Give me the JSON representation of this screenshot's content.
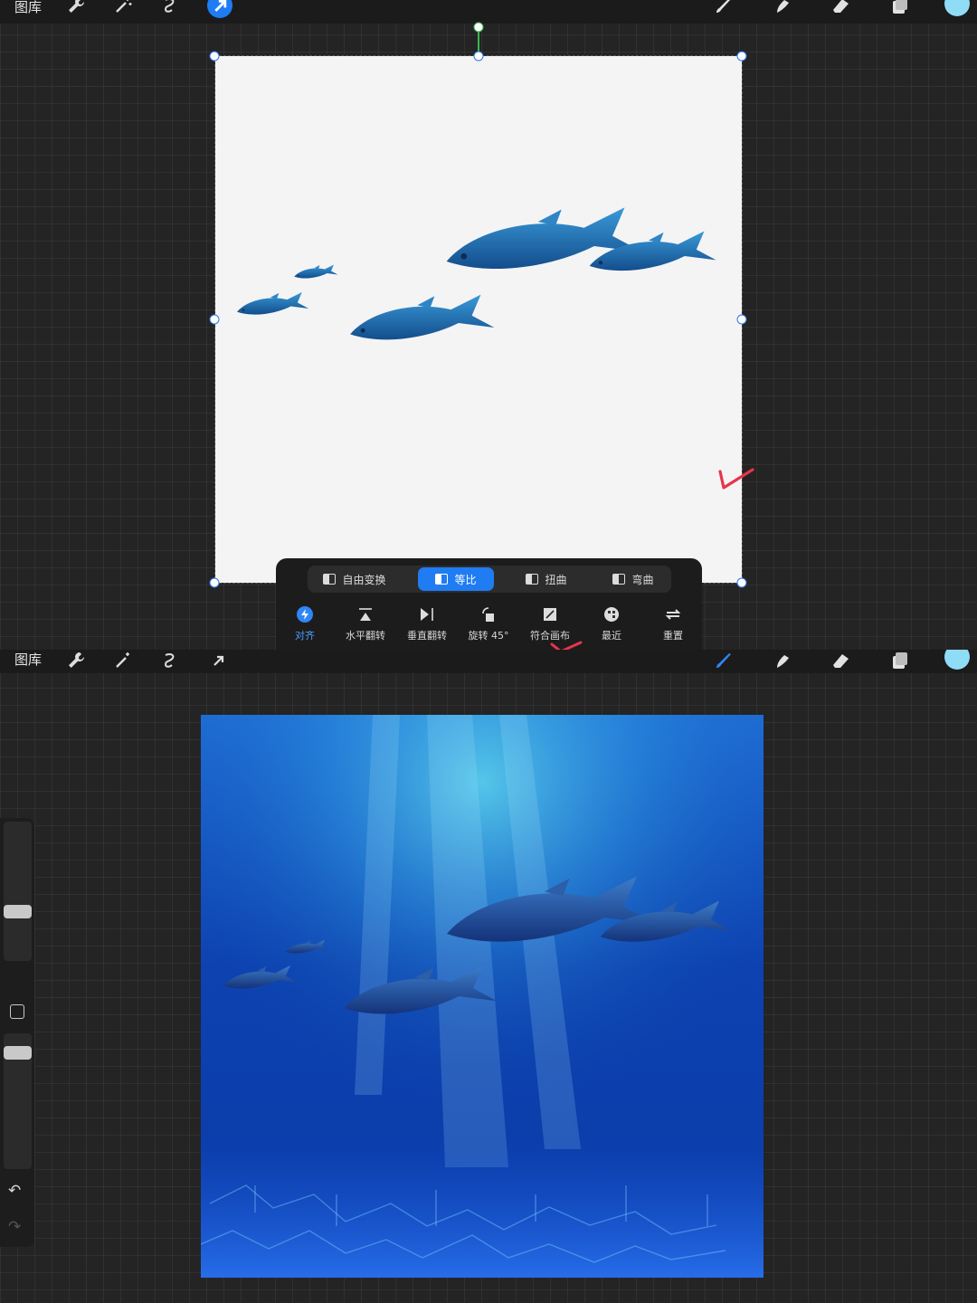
{
  "top_panel": {
    "gallery_label": "图库",
    "toolbar_icons": [
      "wrench-icon",
      "magic-wand-icon",
      "selection-icon",
      "transform-arrow-icon"
    ],
    "right_tools": [
      "brush-icon",
      "smudge-icon",
      "eraser-icon",
      "layers-icon"
    ],
    "color_swatch": "#8fdcf7",
    "transform_modes": [
      {
        "label": "自由变换",
        "active": false
      },
      {
        "label": "等比",
        "active": true
      },
      {
        "label": "扭曲",
        "active": false
      },
      {
        "label": "弯曲",
        "active": false
      }
    ],
    "transform_options": [
      {
        "label": "对齐",
        "icon": "snapping-icon",
        "active": true
      },
      {
        "label": "水平翻转",
        "icon": "flip-horizontal-icon"
      },
      {
        "label": "垂直翻转",
        "icon": "flip-vertical-icon"
      },
      {
        "label": "旋转 45°",
        "icon": "rotate-icon"
      },
      {
        "label": "符合画布",
        "icon": "fit-canvas-icon"
      },
      {
        "label": "最近",
        "icon": "interpolation-icon"
      },
      {
        "label": "重置",
        "icon": "reset-icon"
      }
    ],
    "accent_color": "#1f7cf2"
  },
  "bottom_panel": {
    "gallery_label": "图库",
    "toolbar_icons": [
      "wrench-icon",
      "magic-wand-icon",
      "selection-icon",
      "transform-arrow-icon"
    ],
    "right_tools": [
      "brush-icon",
      "smudge-icon",
      "eraser-icon",
      "layers-icon"
    ],
    "color_swatch": "#8fdcf7",
    "sidebar_controls": [
      "brush-size-slider",
      "modify-button",
      "opacity-slider",
      "undo-icon",
      "redo-icon"
    ],
    "brush_size_level": 0.4,
    "opacity_level": 0.75
  }
}
